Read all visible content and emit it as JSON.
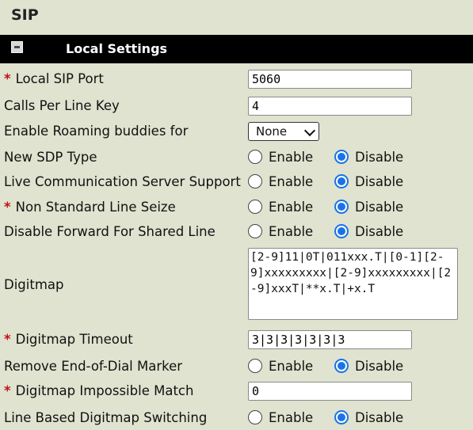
{
  "page": {
    "title": "SIP"
  },
  "section": {
    "title": "Local Settings"
  },
  "radio_labels": {
    "enable": "Enable",
    "disable": "Disable"
  },
  "fields": {
    "local_sip_port": {
      "label": "Local SIP Port",
      "value": "5060"
    },
    "calls_per_line_key": {
      "label": "Calls Per Line Key",
      "value": "4"
    },
    "enable_roaming_buddies": {
      "label": "Enable Roaming buddies for",
      "value": "None"
    },
    "new_sdp_type": {
      "label": "New SDP Type",
      "value": "Disable"
    },
    "live_comm_server_support": {
      "label": "Live Communication Server Support",
      "value": "Disable"
    },
    "non_standard_line_seize": {
      "label": "Non Standard Line Seize",
      "value": "Disable"
    },
    "disable_forward_shared_line": {
      "label": "Disable Forward For Shared Line",
      "value": "Disable"
    },
    "digitmap": {
      "label": "Digitmap",
      "value": "[2-9]11|0T|011xxx.T|[0-1][2-9]xxxxxxxxx|[2-9]xxxxxxxxx|[2-9]xxxT|**x.T|+x.T"
    },
    "digitmap_timeout": {
      "label": "Digitmap Timeout",
      "value": "3|3|3|3|3|3|3"
    },
    "remove_end_of_dial_marker": {
      "label": "Remove End-of-Dial Marker",
      "value": "Disable"
    },
    "digitmap_impossible_match": {
      "label": "Digitmap Impossible Match",
      "value": "0"
    },
    "line_based_digitmap_switching": {
      "label": "Line Based Digitmap Switching",
      "value": "Disable"
    }
  },
  "required_marker": "*",
  "colors": {
    "background": "#dfe3cf",
    "section_bar": "#000000",
    "required": "#c41010",
    "radio_checked": "#1a73e8"
  }
}
